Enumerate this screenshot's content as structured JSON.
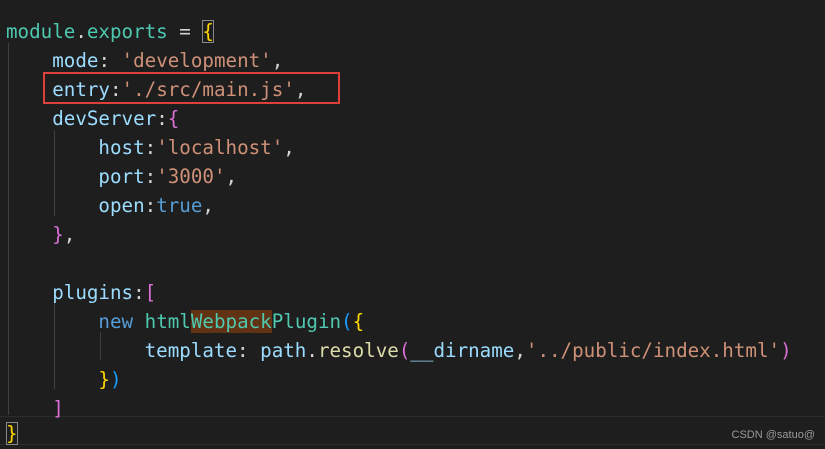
{
  "editor": {
    "lines": {
      "l1": {
        "t1": "module",
        "t2": ".",
        "t3": "exports",
        "t4": " = ",
        "t5": "{"
      },
      "l2": {
        "t1": "mode",
        "t2": ": ",
        "t3": "'development'",
        "t4": ","
      },
      "l3": {
        "t1": "entry",
        "t2": ":",
        "t3": "'./src/main.js'",
        "t4": ","
      },
      "l4": {
        "t1": "devServer",
        "t2": ":",
        "t3": "{"
      },
      "l5": {
        "t1": "host",
        "t2": ":",
        "t3": "'localhost'",
        "t4": ","
      },
      "l6": {
        "t1": "port",
        "t2": ":",
        "t3": "'3000'",
        "t4": ","
      },
      "l7": {
        "t1": "open",
        "t2": ":",
        "t3": "true",
        "t4": ","
      },
      "l8": {
        "t1": "}",
        "t2": ","
      },
      "l9": {
        "t1": "plugins",
        "t2": ":",
        "t3": "["
      },
      "l10": {
        "t1": "new",
        "t2": " ",
        "t3": "html",
        "t4": "Webpack",
        "t5": "Plugin",
        "t6": "(",
        "t7": "{"
      },
      "l11": {
        "t1": "template",
        "t2": ": ",
        "t3": "path",
        "t4": ".",
        "t5": "resolve",
        "t6": "(",
        "t7": "__dirname",
        "t8": ",",
        "t9": "'../public/index.html'",
        "t10": ")"
      },
      "l12": {
        "t1": "}",
        "t2": ")"
      },
      "l13": {
        "t1": "]"
      },
      "l14": {
        "t1": "}"
      }
    },
    "colors": {
      "background": "#1e1e1e",
      "string": "#ce9178",
      "keyword": "#569cd6",
      "property": "#9cdcfe",
      "function": "#dcdcaa",
      "bracket_level1": "#ffd700",
      "bracket_level2": "#da70d6",
      "bracket_level3": "#179fff",
      "annotation_box": "#e0403a"
    }
  },
  "watermark": {
    "text": "CSDN @satuo@"
  }
}
